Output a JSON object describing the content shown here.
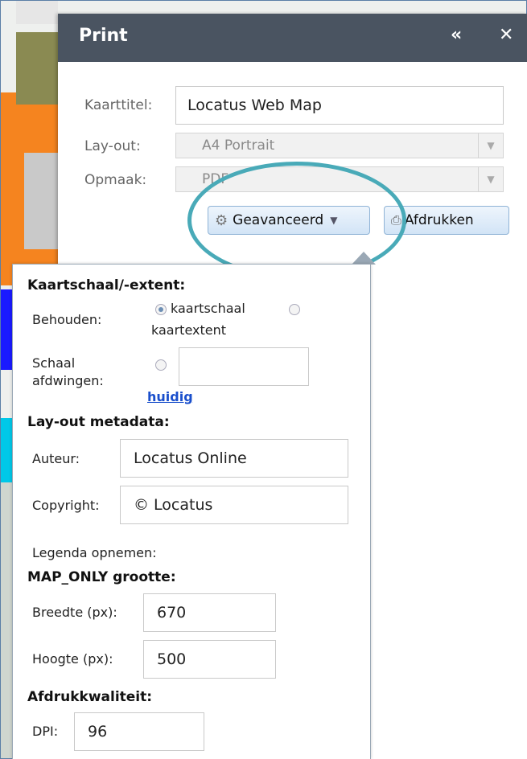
{
  "panel": {
    "title": "Print",
    "collapse_icon": "double-chevron-up-icon",
    "close_icon": "close-icon",
    "title_label": "Kaarttitel:",
    "title_value": "Locatus Web Map",
    "layout_label": "Lay-out:",
    "layout_value": "A4 Portrait",
    "format_label": "Opmaak:",
    "format_value": "PDF",
    "advanced_button": "Geavanceerd",
    "print_button": "Afdrukken"
  },
  "advanced": {
    "scale_section": "Kaartschaal/-extent:",
    "preserve_label": "Behouden:",
    "option_scale": "kaartschaal",
    "option_extent": "kaartextent",
    "force_scale_label_1": "Schaal",
    "force_scale_label_2": "afdwingen:",
    "current_link": "huidig",
    "metadata_section": "Lay-out metadata:",
    "author_label": "Auteur:",
    "author_value": "Locatus Online",
    "copyright_label": "Copyright:",
    "copyright_value": "© Locatus",
    "legend_label": "Legenda opnemen:",
    "maponly_section": "MAP_ONLY grootte:",
    "width_label": "Breedte (px):",
    "width_value": "670",
    "height_label": "Hoogte (px):",
    "height_value": "500",
    "quality_section": "Afdrukkwaliteit:",
    "dpi_label": "DPI:",
    "dpi_value": "96"
  },
  "colors": {
    "header_bg": "#4a5461",
    "highlight_circle": "#49aab8",
    "link": "#1a4fcc"
  }
}
